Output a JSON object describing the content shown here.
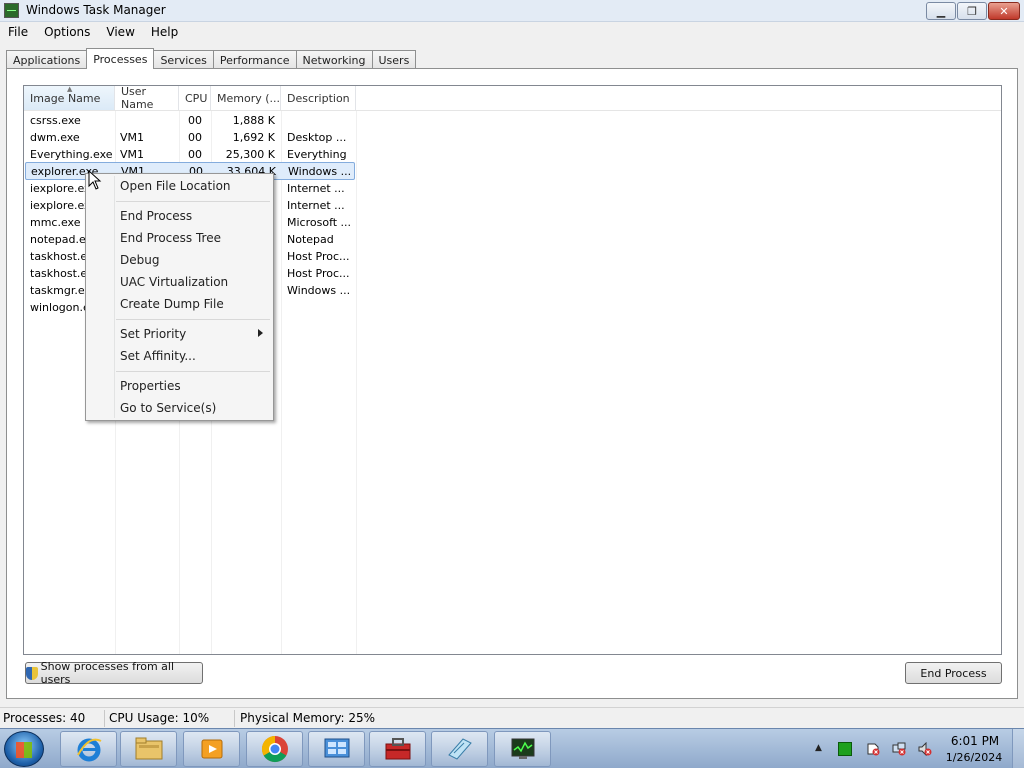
{
  "window": {
    "title": "Windows Task Manager"
  },
  "menu": [
    "File",
    "Options",
    "View",
    "Help"
  ],
  "tabs": [
    "Applications",
    "Processes",
    "Services",
    "Performance",
    "Networking",
    "Users"
  ],
  "active_tab": "Processes",
  "columns": {
    "name": "Image Name",
    "user": "User Name",
    "cpu": "CPU",
    "memory": "Memory (...",
    "description": "Description"
  },
  "processes": [
    {
      "name": "csrss.exe",
      "user": "",
      "cpu": "00",
      "memory": "1,888 K",
      "description": ""
    },
    {
      "name": "dwm.exe",
      "user": "VM1",
      "cpu": "00",
      "memory": "1,692 K",
      "description": "Desktop ..."
    },
    {
      "name": "Everything.exe",
      "user": "VM1",
      "cpu": "00",
      "memory": "25,300 K",
      "description": "Everything"
    },
    {
      "name": "explorer.exe",
      "user": "VM1",
      "cpu": "00",
      "memory": "33,604 K",
      "description": "Windows ..."
    },
    {
      "name": "iexplore.exe",
      "user": "",
      "cpu": "",
      "memory": "",
      "description": "Internet ..."
    },
    {
      "name": "iexplore.exe",
      "user": "",
      "cpu": "",
      "memory": "",
      "description": "Internet ..."
    },
    {
      "name": "mmc.exe",
      "user": "",
      "cpu": "",
      "memory": "",
      "description": "Microsoft ..."
    },
    {
      "name": "notepad.exe",
      "user": "",
      "cpu": "",
      "memory": "",
      "description": "Notepad"
    },
    {
      "name": "taskhost.exe",
      "user": "",
      "cpu": "",
      "memory": "",
      "description": "Host Proc..."
    },
    {
      "name": "taskhost.exe",
      "user": "",
      "cpu": "",
      "memory": "",
      "description": "Host Proc..."
    },
    {
      "name": "taskmgr.exe",
      "user": "",
      "cpu": "",
      "memory": "",
      "description": "Windows ..."
    },
    {
      "name": "winlogon.exe",
      "user": "",
      "cpu": "",
      "memory": "",
      "description": ""
    }
  ],
  "context_menu": {
    "open_file_location": "Open File Location",
    "end_process": "End Process",
    "end_process_tree": "End Process Tree",
    "debug": "Debug",
    "uac_virtualization": "UAC Virtualization",
    "create_dump_file": "Create Dump File",
    "set_priority": "Set Priority",
    "set_affinity": "Set Affinity...",
    "properties": "Properties",
    "go_to_services": "Go to Service(s)"
  },
  "buttons": {
    "show_all": "Show processes from all users",
    "end_process": "End Process"
  },
  "status": {
    "processes": "Processes: 40",
    "cpu": "CPU Usage: 10%",
    "memory": "Physical Memory: 25%"
  },
  "clock": {
    "time": "6:01 PM",
    "date": "1/26/2024"
  },
  "taskbar_apps": [
    "internet-explorer-icon",
    "file-explorer-icon",
    "media-player-icon",
    "chrome-icon",
    "control-panel-icon",
    "toolbox-icon",
    "notepad-icon",
    "task-manager-icon"
  ]
}
